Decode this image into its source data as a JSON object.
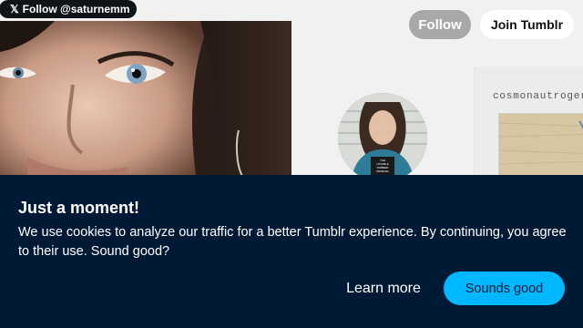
{
  "x_follow": {
    "logo": "𝕏",
    "label": "Follow @saturnemm"
  },
  "header": {
    "follow_label": "Follow",
    "join_label": "Join Tumblr"
  },
  "sidebar_post": {
    "reblog_user": "cosmonautroger:"
  },
  "avatar": {
    "caption_lines": [
      "THE",
      "LOVABLE",
      "ROBBER",
      "CRIMINAL"
    ]
  },
  "cookie_banner": {
    "title": "Just a moment!",
    "message": "We use cookies to analyze our traffic for a better Tumblr experience. By continuing, you agree to their use. Sound good?",
    "learn_more_label": "Learn more",
    "accept_label": "Sounds good"
  },
  "colors": {
    "banner_bg": "#001935",
    "accept_bg": "#00b8ff",
    "follow_bg": "#a8a8a8",
    "page_bg": "#f1f1f1"
  }
}
